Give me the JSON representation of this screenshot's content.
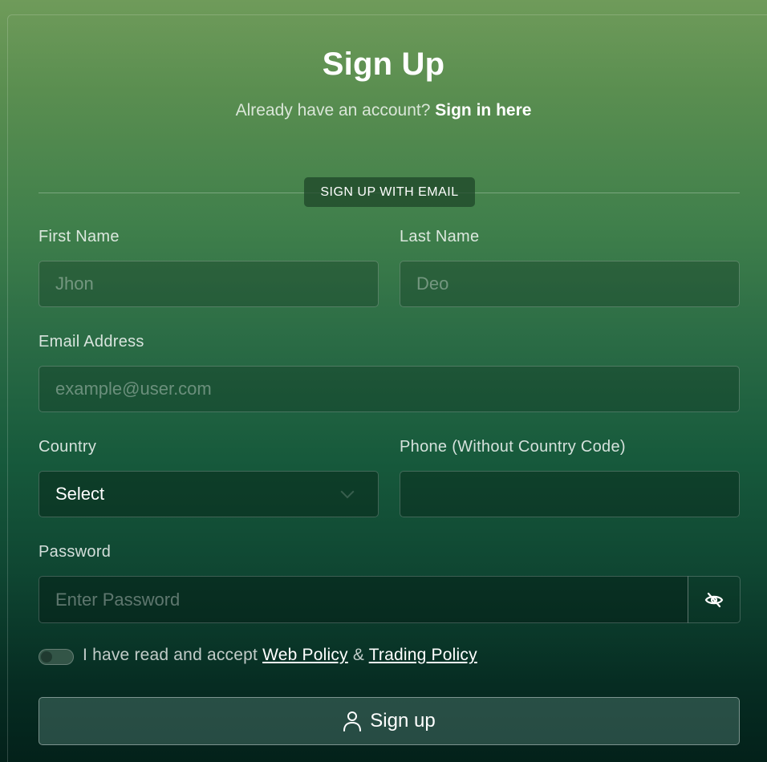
{
  "header": {
    "title": "Sign Up",
    "subtitle_prefix": "Already have an account?",
    "signin_link": "Sign in here"
  },
  "divider": {
    "label": "SIGN UP WITH EMAIL"
  },
  "form": {
    "first_name": {
      "label": "First Name",
      "placeholder": "Jhon",
      "value": ""
    },
    "last_name": {
      "label": "Last Name",
      "placeholder": "Deo",
      "value": ""
    },
    "email": {
      "label": "Email Address",
      "placeholder": "example@user.com",
      "value": ""
    },
    "country": {
      "label": "Country",
      "selected": "Select"
    },
    "phone": {
      "label": "Phone (Without Country Code)",
      "placeholder": "",
      "value": ""
    },
    "password": {
      "label": "Password",
      "placeholder": "Enter Password",
      "value": "",
      "toggle_icon": "eye-off-icon"
    }
  },
  "terms": {
    "accepted": false,
    "prefix": "I have read and accept",
    "web_policy": "Web Policy",
    "separator": "&",
    "trading_policy": "Trading Policy"
  },
  "submit": {
    "icon": "user-icon",
    "label": "Sign up"
  }
}
